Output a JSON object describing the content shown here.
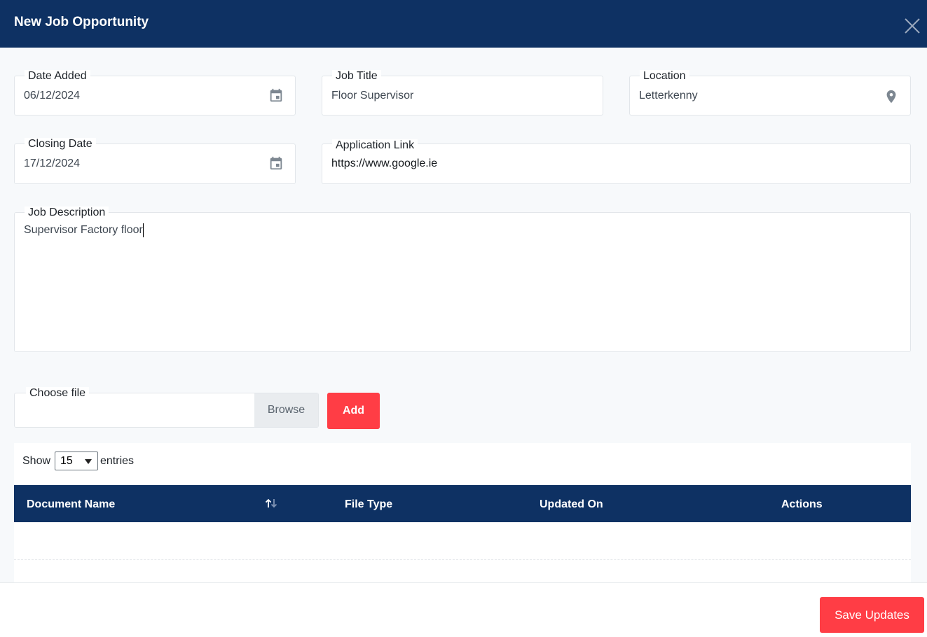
{
  "modal": {
    "title": "New Job Opportunity",
    "close_icon": "close-icon"
  },
  "form": {
    "date_added": {
      "label": "Date Added",
      "value": "06/12/2024",
      "icon": "calendar-icon"
    },
    "job_title": {
      "label": "Job Title",
      "value": "Floor Supervisor"
    },
    "location": {
      "label": "Location",
      "value": "Letterkenny",
      "icon": "map-pin-icon"
    },
    "closing_date": {
      "label": "Closing Date",
      "value": "17/12/2024",
      "icon": "calendar-icon"
    },
    "application_link": {
      "label": "Application Link",
      "value": "https://www.google.ie"
    },
    "job_description": {
      "label": "Job Description",
      "value": "Supervisor Factory floor"
    }
  },
  "file_upload": {
    "label": "Choose file",
    "browse_label": "Browse",
    "add_label": "Add"
  },
  "table": {
    "show_label": "Show",
    "page_size": "15",
    "entries_label": "entries",
    "columns": [
      "Document Name",
      "File Type",
      "Updated On",
      "Actions"
    ],
    "rows": []
  },
  "footer": {
    "save_label": "Save Updates"
  },
  "colors": {
    "header": "#0e3163",
    "accent": "#ff3d45",
    "background": "#f7f9fb"
  }
}
